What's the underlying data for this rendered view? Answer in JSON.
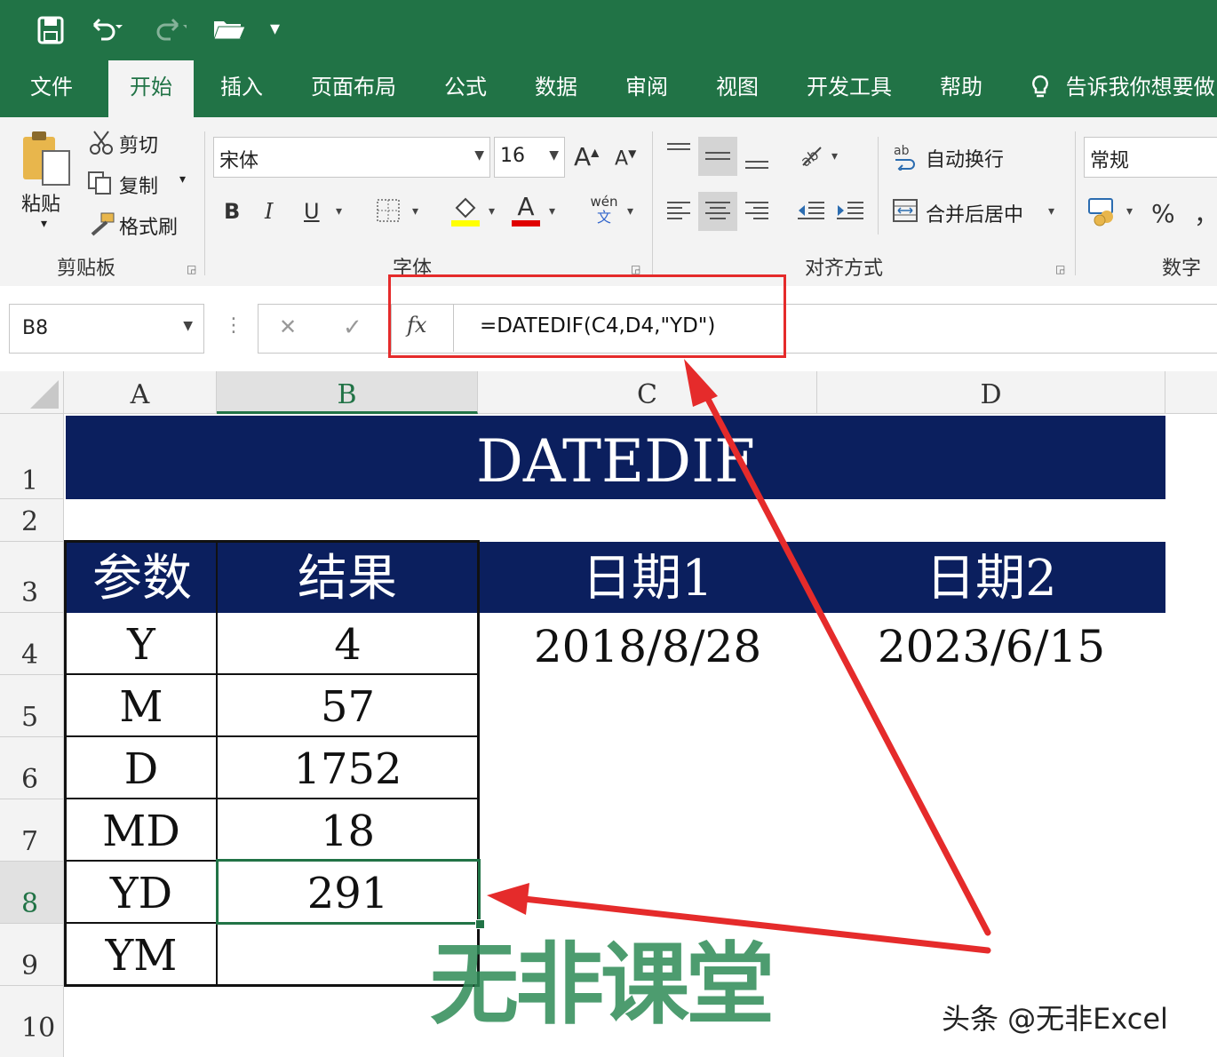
{
  "qat": {
    "save_icon": "save-icon",
    "undo_icon": "undo-icon",
    "redo_icon": "redo-icon",
    "open_icon": "folder-icon",
    "customize": "▾"
  },
  "tabs": [
    "文件",
    "开始",
    "插入",
    "页面布局",
    "公式",
    "数据",
    "审阅",
    "视图",
    "开发工具",
    "帮助",
    "告诉我你想要做"
  ],
  "active_tab": "开始",
  "clipboard": {
    "paste": "粘贴",
    "cut": "剪切",
    "copy": "复制",
    "format_painter": "格式刷",
    "group": "剪贴板"
  },
  "font": {
    "name": "宋体",
    "size": "16",
    "bold": "B",
    "italic": "I",
    "underline": "U",
    "group": "字体",
    "grow": "A",
    "shrink": "A",
    "font_color": "A",
    "phonetic_top": "wén",
    "phonetic_bottom": "文"
  },
  "alignment": {
    "wrap": "自动换行",
    "merge": "合并后居中",
    "group": "对齐方式"
  },
  "number": {
    "format": "常规",
    "percent": "%",
    "comma": "，",
    "group": "数字"
  },
  "formula_bar": {
    "name_box": "B8",
    "cancel": "✕",
    "enter": "✓",
    "fx": "fx",
    "formula": "=DATEDIF(C4,D4,\"YD\")"
  },
  "columns": [
    "A",
    "B",
    "C",
    "D"
  ],
  "rows": [
    "1",
    "2",
    "3",
    "4",
    "5",
    "6",
    "7",
    "8",
    "9",
    "10"
  ],
  "sheet": {
    "title": "DATEDIF",
    "header": {
      "param": "参数",
      "result": "结果",
      "date1": "日期1",
      "date2": "日期2"
    },
    "date1_value": "2018/8/28",
    "date2_value": "2023/6/15",
    "table": [
      {
        "param": "Y",
        "result": "4"
      },
      {
        "param": "M",
        "result": "57"
      },
      {
        "param": "D",
        "result": "1752"
      },
      {
        "param": "MD",
        "result": "18"
      },
      {
        "param": "YD",
        "result": "291"
      },
      {
        "param": "YM",
        "result": ""
      }
    ]
  },
  "watermark": "无非课堂",
  "credit": "头条 @无非Excel",
  "colors": {
    "excel_green": "#217346",
    "navy": "#0b1f5e",
    "arrow_red": "#e52b2b",
    "watermark_green": "#2e8b57"
  }
}
